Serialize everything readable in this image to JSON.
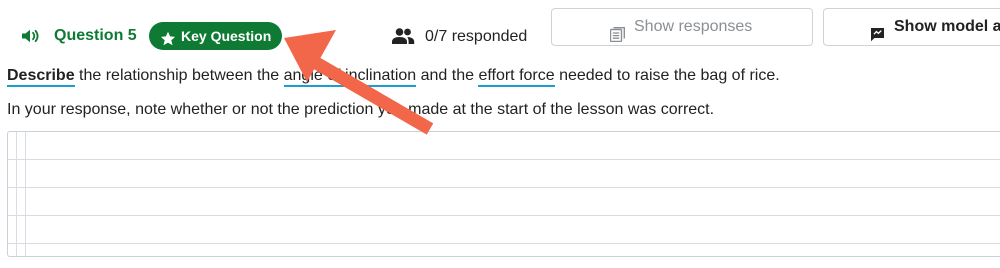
{
  "header": {
    "question_label": "Question 5",
    "key_badge_label": "Key Question",
    "responded_text": "0/7 responded",
    "show_responses_label": "Show responses",
    "show_model_label": "Show model a"
  },
  "prompt": {
    "verb": "Describe",
    "part1": " the relationship between the ",
    "term1": "angle of inclination",
    "part2": " and the ",
    "term2": "effort force",
    "part3": " needed to raise the bag of rice."
  },
  "note": "In your response, note whether or not the prediction you made at the start of the lesson was correct.",
  "response": {
    "value": ""
  },
  "colors": {
    "accent_green": "#0f7a34",
    "vocab_underline": "#1a9fd0",
    "annotation_arrow": "#f2674a"
  },
  "icons": {
    "audio": "speaker-icon",
    "badge": "star-icon",
    "responded": "people-icon",
    "responses": "list-icon",
    "model": "comment-icon"
  }
}
